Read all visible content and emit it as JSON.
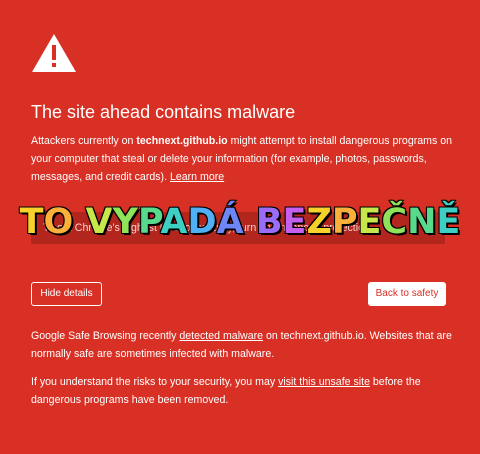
{
  "colors": {
    "background": "#d93025",
    "text": "#ffffff",
    "primary_button_text": "#d93025"
  },
  "header": {
    "icon": "warning-triangle-icon",
    "title": "The site ahead contains malware"
  },
  "description": {
    "part1": "Attackers currently on ",
    "site": "technext.github.io",
    "part2": " might attempt to install dangerous programs on your computer that steal or delete your information (for example, photos, passwords, messages, and credit cards). ",
    "learn_more": "Learn more"
  },
  "enhanced_protection": {
    "text": "To get Chrome's highest level of security, turn on enhanced protection"
  },
  "overlay": {
    "text": "TO VYPADÁ BEZPEČNĚ"
  },
  "buttons": {
    "hide_details": "Hide details",
    "back_to_safety": "Back to safety"
  },
  "details": {
    "p1_part1": "Google Safe Browsing recently ",
    "p1_link": "detected malware",
    "p1_part2": " on technext.github.io. Websites that are normally safe are sometimes infected with malware.",
    "p2_part1": "If you understand the risks to your security, you may ",
    "p2_link": "visit this unsafe site",
    "p2_part2": " before the dangerous programs have been removed."
  }
}
